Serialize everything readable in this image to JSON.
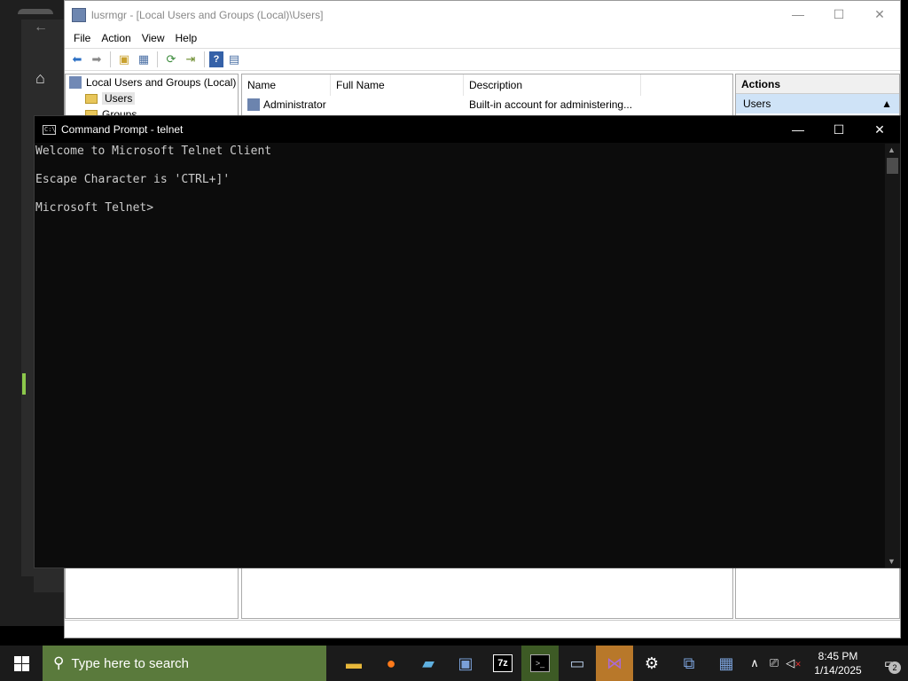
{
  "mmc": {
    "title": "lusrmgr - [Local Users and Groups (Local)\\Users]",
    "menu": [
      "File",
      "Action",
      "View",
      "Help"
    ],
    "tree": {
      "root": "Local Users and Groups (Local)",
      "users": "Users",
      "groups": "Groups"
    },
    "columns": {
      "name": "Name",
      "full_name": "Full Name",
      "description": "Description"
    },
    "rows": [
      {
        "name": "Administrator",
        "full_name": "",
        "description": "Built-in account for administering..."
      }
    ],
    "actions": {
      "header": "Actions",
      "section": "Users"
    }
  },
  "cmd": {
    "title": "Command Prompt - telnet",
    "line1": "Welcome to Microsoft Telnet Client",
    "line2": "Escape Character is 'CTRL+]'",
    "line3": "Microsoft Telnet>"
  },
  "taskbar": {
    "search_placeholder": "Type here to search",
    "time": "8:45 PM",
    "date": "1/14/2025",
    "notification_count": "2",
    "accent_color": "#5a7a3c"
  }
}
